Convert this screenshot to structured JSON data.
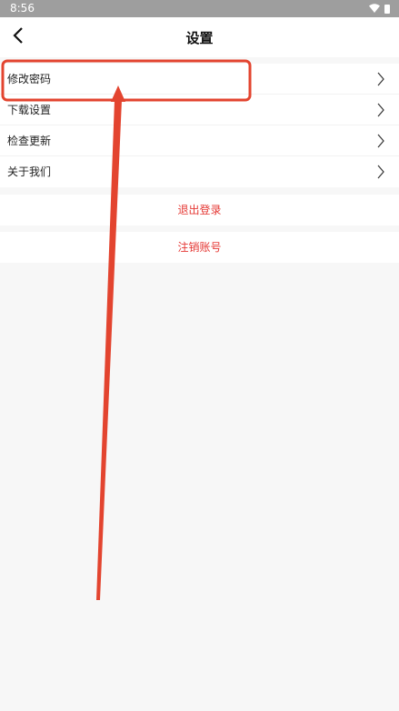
{
  "status_bar": {
    "time": "8:56",
    "icons": [
      "wifi-icon",
      "battery-icon"
    ]
  },
  "header": {
    "title": "设置",
    "back_icon": "chevron-left-icon"
  },
  "menu": {
    "items": [
      {
        "label": "修改密码",
        "icon": "chevron-right-icon"
      },
      {
        "label": "下载设置",
        "icon": "chevron-right-icon"
      },
      {
        "label": "检查更新",
        "icon": "chevron-right-icon"
      },
      {
        "label": "关于我们",
        "icon": "chevron-right-icon"
      }
    ]
  },
  "actions": {
    "logout_label": "退出登录",
    "cancel_account_label": "注销账号"
  },
  "colors": {
    "danger": "#e53935",
    "annotation": "#e3442f",
    "status_bar": "#9e9e9e",
    "page_background": "#f7f7f7"
  }
}
